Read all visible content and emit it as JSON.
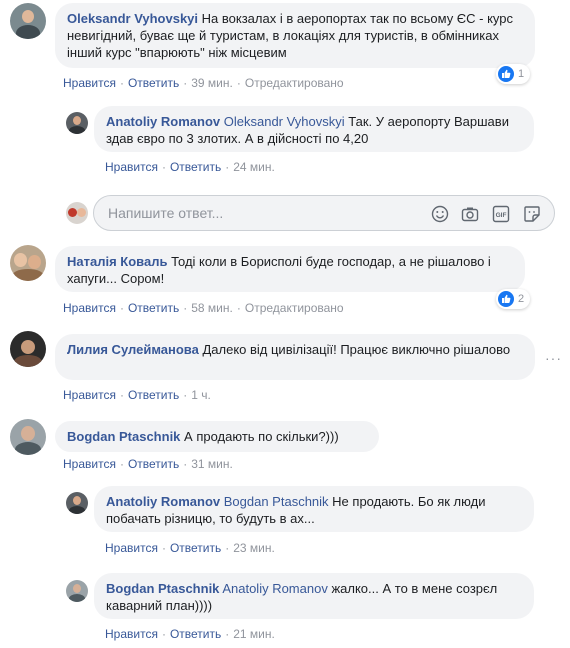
{
  "comments": [
    {
      "author": "Oleksandr Vyhovskyi",
      "text": "На вокзалах і в аеропортах так по всьому ЄС - курс невигідний, буває ще й туристам, в локаціях для туристів, в обмінниках інший курс \"впарюють\" ніж місцевим",
      "like": "Нравится",
      "reply": "Ответить",
      "time": "39 мин.",
      "edited": "Отредактировано",
      "reactions": "1",
      "replies": [
        {
          "author": "Anatoliy Romanov",
          "mention": "Oleksandr Vyhovskyi",
          "text": "Так. У аеропорту Варшави здав євро по 3 злотих. А в дійсності по 4,20",
          "like": "Нравится",
          "reply": "Ответить",
          "time": "24 мин."
        }
      ]
    },
    {
      "author": "Наталія Коваль",
      "text": "Тоді коли в Борисполі буде господар, а не рішалово і хапуги... Сором!",
      "like": "Нравится",
      "reply": "Ответить",
      "time": "58 мин.",
      "edited": "Отредактировано",
      "reactions": "2"
    },
    {
      "author": "Лилия Сулейманова",
      "text": "Далеко від цивілізації! Працює виключно рішалово",
      "like": "Нравится",
      "reply": "Ответить",
      "time": "1 ч."
    },
    {
      "author": "Bogdan Ptaschnik",
      "text": "А продають по скільки?)))",
      "like": "Нравится",
      "reply": "Ответить",
      "time": "31 мин.",
      "replies": [
        {
          "author": "Anatoliy Romanov",
          "mention": "Bogdan Ptaschnik",
          "text": "Не продають. Бо як люди побачать різницю, то будуть в ах...",
          "like": "Нравится",
          "reply": "Ответить",
          "time": "23 мин."
        },
        {
          "author": "Bogdan Ptaschnik",
          "mention": "Anatoliy Romanov",
          "text": "жалко... А то в мене созрєл каварний план))))",
          "like": "Нравится",
          "reply": "Ответить",
          "time": "21 мин."
        }
      ]
    }
  ],
  "reply_box": {
    "placeholder": "Напишите ответ..."
  },
  "icons": [
    "smile-icon",
    "camera-icon",
    "gif-icon",
    "sticker-icon",
    "like-icon",
    "more-icon"
  ],
  "colors": {
    "link": "#385898",
    "bubble": "#f2f3f5",
    "meta": "#90949c",
    "like": "#1877f2"
  }
}
